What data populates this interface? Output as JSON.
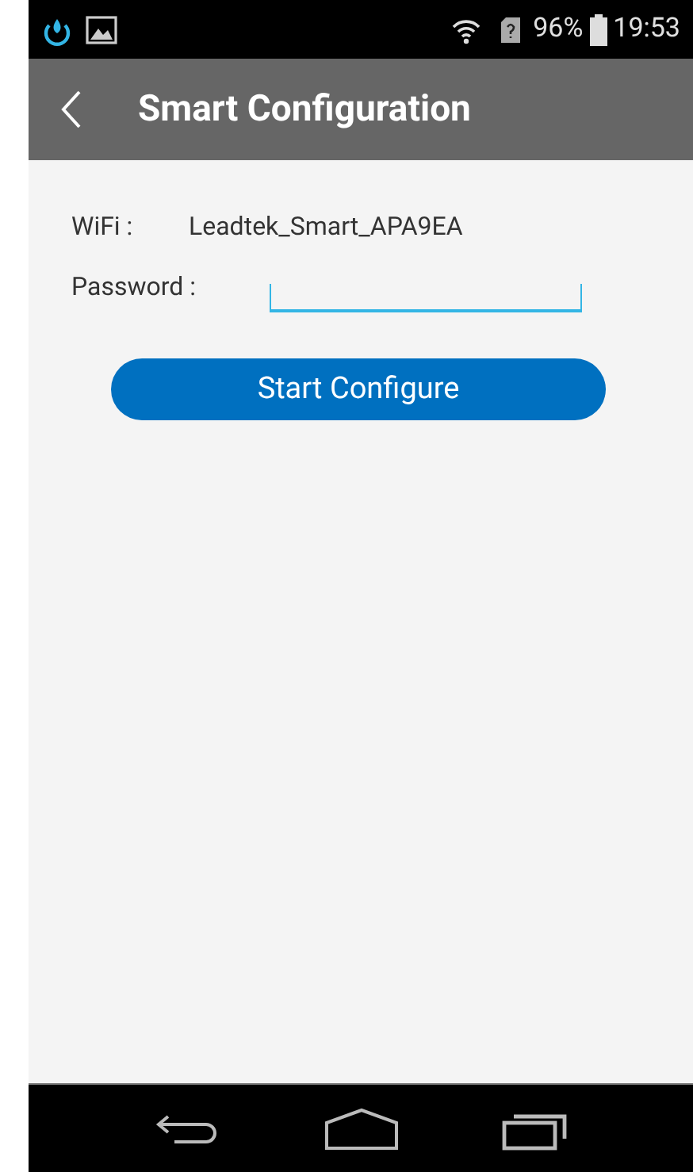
{
  "status_bar": {
    "battery": "96%",
    "time": "19:53"
  },
  "header": {
    "title": "Smart Configuration"
  },
  "form": {
    "wifi_label": "WiFi :",
    "wifi_value": "Leadtek_Smart_APA9EA",
    "password_label": "Password :"
  },
  "button": {
    "label": "Start Configure"
  }
}
